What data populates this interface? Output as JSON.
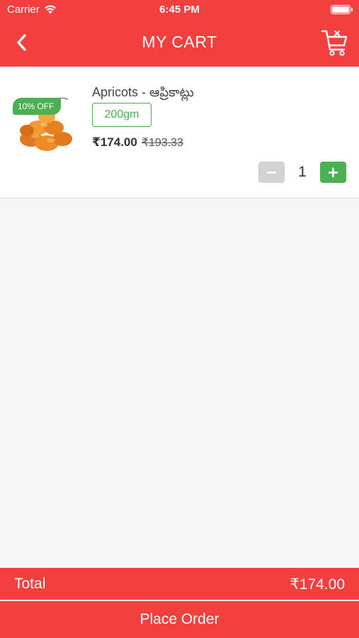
{
  "status_bar": {
    "carrier": "Carrier",
    "time": "6:45 PM"
  },
  "header": {
    "title": "MY CART",
    "back_icon": "chevron-left-icon",
    "clear_cart_icon": "cart-clear-icon"
  },
  "cart": {
    "items": [
      {
        "name": "Apricots - ఆప్రికాట్లు",
        "discount_badge": "10% OFF",
        "size": "200gm",
        "price": "₹174.00",
        "mrp": "₹193.33",
        "quantity": "1",
        "minus_label": "−",
        "plus_label": "+"
      }
    ]
  },
  "footer": {
    "total_label": "Total",
    "total_value": "₹174.00",
    "place_order_label": "Place Order"
  },
  "colors": {
    "brand_red": "#f43f3f",
    "accent_green": "#4cb050"
  }
}
